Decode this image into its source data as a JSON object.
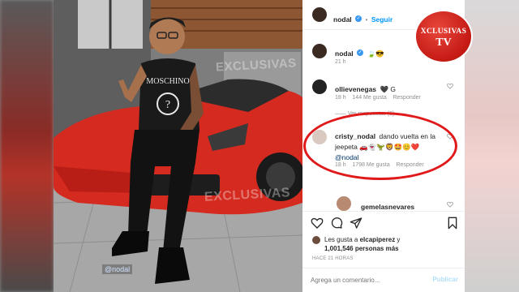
{
  "post": {
    "author": "nodal",
    "follow_label": "Seguir",
    "caption_author": "nodal",
    "caption_text": "🍃😎",
    "caption_time": "21 h"
  },
  "photo": {
    "watermark_top": "EXCLUSIVAS",
    "watermark_bottom": "EXCLUSIVAS",
    "tag": "@nodal"
  },
  "comments": [
    {
      "user": "ollievenegas",
      "text": "🖤 G",
      "time": "18 h",
      "likes": "144 Me gusta",
      "reply": "Responder",
      "view_replies": "Ver respuestas (3)"
    },
    {
      "user": "cristy_nodal",
      "text_line1": "dando vuelta en la",
      "text_line2": "jeepeta 🚗👻🦖🦁🤩😊❤️",
      "mention": "@nodal",
      "time": "18 h",
      "likes": "1798 Me gusta",
      "reply": "Responder"
    },
    {
      "user": "gemelasnevares",
      "text": ""
    }
  ],
  "likes": {
    "prefix": "Les gusta a",
    "first_user": "elcapiperez",
    "conj": "y",
    "count": "1,001,546 personas más"
  },
  "timestamp": "HACE 21 HORAS",
  "comment_box": {
    "placeholder": "Agrega un comentario...",
    "publish": "Publicar"
  },
  "logo": {
    "line1": "XCLUSIVAS",
    "line2": "TV"
  },
  "colors": {
    "accent_blue": "#0095f6",
    "highlight_red": "#e0191b",
    "car_red": "#d42a1f"
  }
}
